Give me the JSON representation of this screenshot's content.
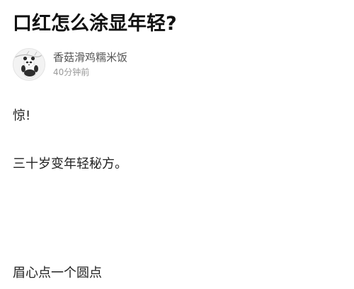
{
  "post": {
    "title": "口红怎么涂显年轻?",
    "author": {
      "name": "香菇滑鸡糯米饭",
      "time": "40分钟前",
      "avatar_icon": "panda-avatar-icon"
    },
    "paragraphs": [
      "惊!",
      "三十岁变年轻秘方。",
      "眉心点一个圆点"
    ]
  }
}
